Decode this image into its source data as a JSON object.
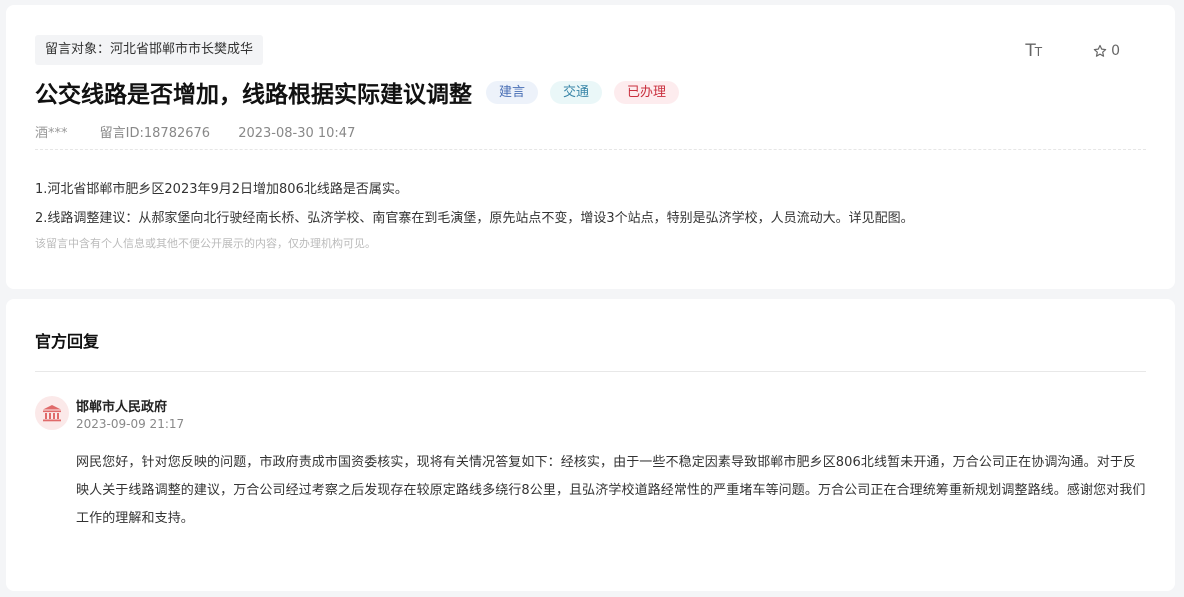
{
  "message": {
    "target": "留言对象：河北省邯郸市市长樊成华",
    "font_toggle": {
      "big": "T",
      "small": "T"
    },
    "favorite_count": "0",
    "title": "公交线路是否增加，线路根据实际建议调整",
    "badges": [
      "建言",
      "交通",
      "已办理"
    ],
    "author": "酒***",
    "id_label": "留言ID:18782676",
    "date": "2023-08-30 10:47",
    "content_lines": [
      "1.河北省邯郸市肥乡区2023年9月2日增加806北线路是否属实。",
      "2.线路调整建议：从郝家堡向北行驶经南长桥、弘济学校、南官寨在到毛演堡，原先站点不变，增设3个站点，特别是弘济学校，人员流动大。详见配图。"
    ],
    "privacy_note": "该留言中含有个人信息或其他不便公开展示的内容，仅办理机构可见。"
  },
  "reply": {
    "heading": "官方回复",
    "org": "邯郸市人民政府",
    "time": "2023-09-09 21:17",
    "text": "网民您好，针对您反映的问题，市政府责成市国资委核实，现将有关情况答复如下：经核实，由于一些不稳定因素导致邯郸市肥乡区806北线暂未开通，万合公司正在协调沟通。对于反映人关于线路调整的建议，万合公司经过考察之后发现存在较原定路线多绕行8公里，且弘济学校道路经常性的严重堵车等问题。万合公司正在合理统筹重新规划调整路线。感谢您对我们工作的理解和支持。"
  },
  "colors": {
    "badge_suggestion": "#4a6fb5",
    "badge_traffic": "#3a86a8",
    "badge_done": "#c9303e",
    "org_icon": "#e06a6a"
  }
}
